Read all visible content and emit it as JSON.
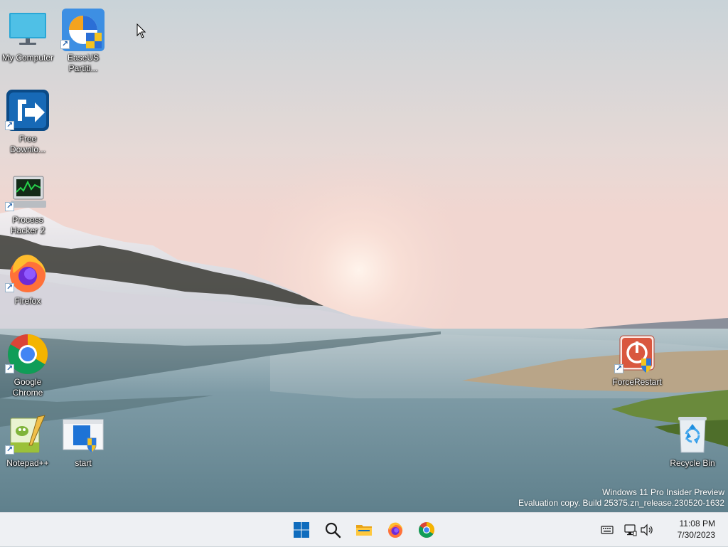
{
  "desktop": {
    "icons": [
      {
        "label": "My Computer"
      },
      {
        "label": "EaseUS Partiti..."
      },
      {
        "label": "Free Downlo..."
      },
      {
        "label": "Process Hacker 2"
      },
      {
        "label": "Firefox"
      },
      {
        "label": "Google Chrome"
      },
      {
        "label": "Notepad++"
      },
      {
        "label": "start"
      },
      {
        "label": "ForceRestart"
      },
      {
        "label": "Recycle Bin"
      }
    ],
    "watermark": {
      "line1": "Windows 11 Pro Insider Preview",
      "line2": "Evaluation copy. Build 25375.zn_release.230520-1632"
    }
  },
  "taskbar": {
    "pinned": [
      {
        "icon": "windows-start-icon"
      },
      {
        "icon": "search-icon"
      },
      {
        "icon": "file-explorer-icon"
      },
      {
        "icon": "firefox-icon"
      },
      {
        "icon": "chrome-icon"
      }
    ],
    "tray": {
      "icons": [
        "keyboard-icon",
        "network-icon",
        "volume-icon"
      ],
      "time": "11:08 PM",
      "date": "7/30/2023"
    }
  },
  "colors": {
    "taskbar_bg": "#eef0f3",
    "accent_blue": "#0f6cbd"
  }
}
